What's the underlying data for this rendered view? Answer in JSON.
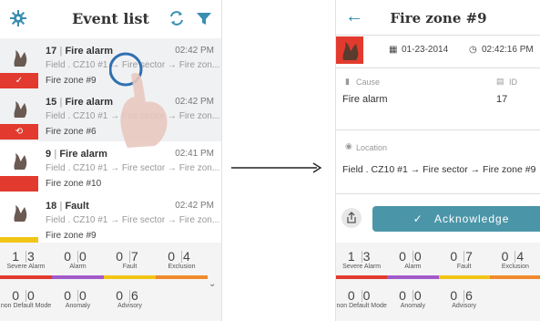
{
  "left": {
    "title": "Event list",
    "events": [
      {
        "id": "17",
        "type": "Fire alarm",
        "time": "02:42 PM",
        "path": "Field . CZ10 #1 → Fire sector → Fire zon...",
        "zone": "Fire zone #9",
        "mark": "✓",
        "mark_color": "#e23a2e",
        "selected": true
      },
      {
        "id": "15",
        "type": "Fire alarm",
        "time": "02:42 PM",
        "path": "Field . CZ10 #1 → Fire sector → Fire zon...",
        "zone": "Fire zone #6",
        "mark": "⟲",
        "mark_color": "#e23a2e",
        "selected": true
      },
      {
        "id": "9",
        "type": "Fire alarm",
        "time": "02:41 PM",
        "path": "Field . CZ10 #1 → Fire sector → Fire zon...",
        "zone": "Fire zone #10",
        "mark": "",
        "mark_color": "#e23a2e",
        "selected": false
      },
      {
        "id": "18",
        "type": "Fault",
        "time": "02:42 PM",
        "path": "Field . CZ10 #1 → Fire sector → Fire zon...",
        "zone": "Fire zone #9",
        "mark": "",
        "mark_color": "#f2c416",
        "selected": false
      }
    ]
  },
  "summary": {
    "row1": [
      {
        "a": "1",
        "b": "3",
        "label": "Severe Alarm",
        "color": "#e23a2e"
      },
      {
        "a": "0",
        "b": "0",
        "label": "Alarm",
        "color": "#a15bc9"
      },
      {
        "a": "0",
        "b": "7",
        "label": "Fault",
        "color": "#f2c416"
      },
      {
        "a": "0",
        "b": "4",
        "label": "Exclusion",
        "color": "#f08a2c"
      }
    ],
    "row2": [
      {
        "a": "0",
        "b": "0",
        "label": "non Default Mode"
      },
      {
        "a": "0",
        "b": "0",
        "label": "Anomaly"
      },
      {
        "a": "0",
        "b": "6",
        "label": "Advisory"
      }
    ]
  },
  "right": {
    "title": "Fire zone #9",
    "date": "01-23-2014",
    "time": "02:42:16 PM",
    "cause_label": "Cause",
    "cause_value": "Fire alarm",
    "id_label": "ID",
    "id_value": "17",
    "location_label": "Location",
    "location_value": "Field . CZ10 #1 → Fire sector → Fire zone #9",
    "acknowledge": "Acknowledge"
  }
}
